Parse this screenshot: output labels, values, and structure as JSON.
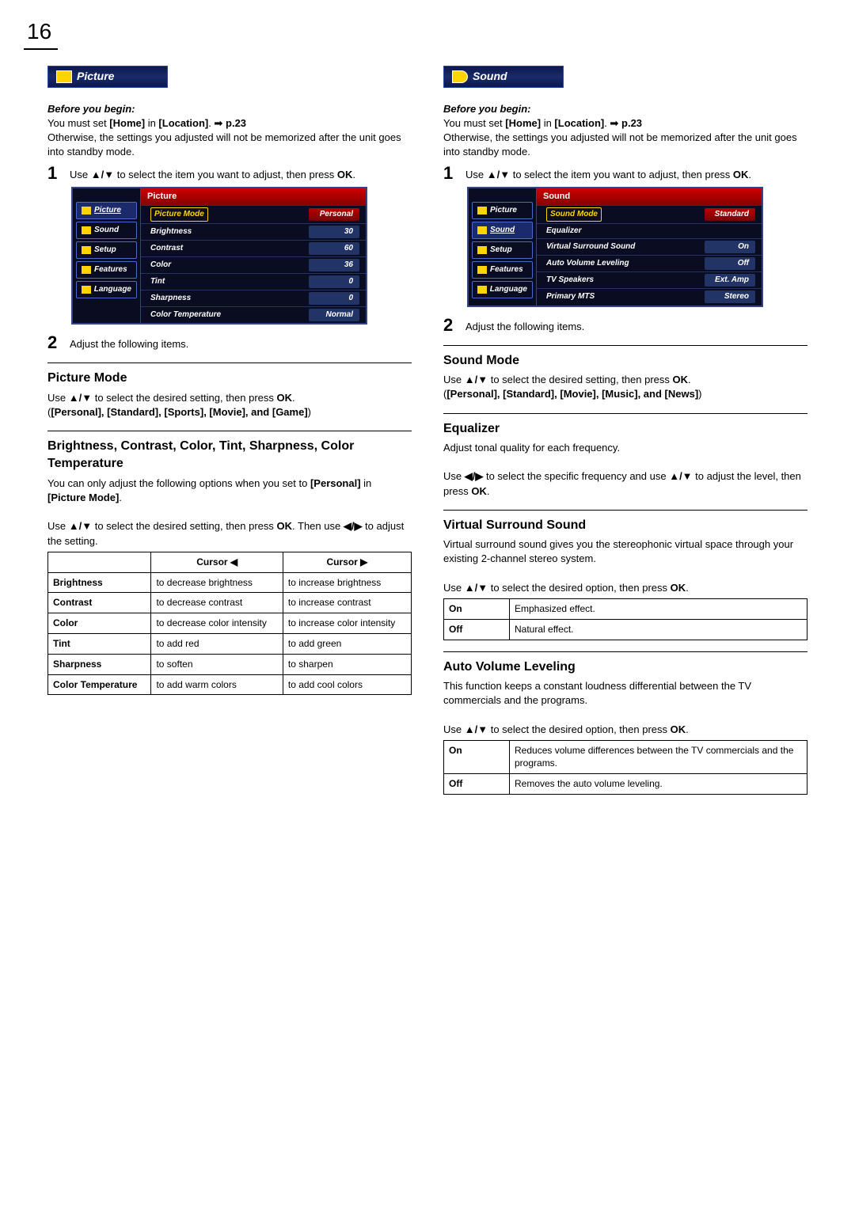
{
  "page_number": "16",
  "left": {
    "tab_title": "Picture",
    "before_heading": "Before you begin:",
    "before_line1_a": "You must set ",
    "before_line1_b": "[Home]",
    "before_line1_c": " in ",
    "before_line1_d": "[Location]",
    "before_line1_e": ". ",
    "before_pref": "p.23",
    "before_line2": "Otherwise, the settings you adjusted will not be memorized after the unit goes into standby mode.",
    "step1_a": "Use ",
    "step1_b": " to select the item you want to adjust, then press ",
    "step1_c": "OK",
    "step1_d": ".",
    "osd_header": "Picture",
    "osd_side": [
      "Picture",
      "Sound",
      "Setup",
      "Features",
      "Language"
    ],
    "osd_rows": [
      {
        "k": "Picture Mode",
        "v": "Personal",
        "hl": true,
        "red": true
      },
      {
        "k": "Brightness",
        "v": "30"
      },
      {
        "k": "Contrast",
        "v": "60"
      },
      {
        "k": "Color",
        "v": "36"
      },
      {
        "k": "Tint",
        "v": "0"
      },
      {
        "k": "Sharpness",
        "v": "0"
      },
      {
        "k": "Color Temperature",
        "v": "Normal"
      }
    ],
    "step2": "Adjust the following items.",
    "pm_head": "Picture Mode",
    "pm_line_a": "Use ",
    "pm_line_b": " to select the desired setting, then press ",
    "pm_line_c": "OK",
    "pm_line_d": ".",
    "pm_opts_a": "(",
    "pm_opts_list": "[Personal], [Standard], [Sports], [Movie], and [Game]",
    "pm_opts_b": ")",
    "bc_head": "Brightness, Contrast, Color, Tint, Sharpness, Color Temperature",
    "bc_line1_a": "You can only adjust the following options when you set to ",
    "bc_line1_b": "[Personal]",
    "bc_line1_c": " in ",
    "bc_line1_d": "[Picture Mode]",
    "bc_line1_e": ".",
    "bc_line2_a": "Use ",
    "bc_line2_b": " to select the desired setting, then press ",
    "bc_line2_c": "OK",
    "bc_line2_d": ". Then use ",
    "bc_line2_e": " to adjust the setting.",
    "bc_table": {
      "head_left": "Cursor ◀",
      "head_right": "Cursor ▶",
      "rows": [
        {
          "label": "Brightness",
          "l": "to decrease brightness",
          "r": "to increase brightness"
        },
        {
          "label": "Contrast",
          "l": "to decrease contrast",
          "r": "to increase contrast"
        },
        {
          "label": "Color",
          "l": "to decrease color intensity",
          "r": "to increase color intensity"
        },
        {
          "label": "Tint",
          "l": "to add red",
          "r": "to add green"
        },
        {
          "label": "Sharpness",
          "l": "to soften",
          "r": "to sharpen"
        },
        {
          "label": "Color Temperature",
          "l": "to add warm colors",
          "r": "to add cool colors"
        }
      ]
    }
  },
  "right": {
    "tab_title": "Sound",
    "before_heading": "Before you begin:",
    "before_line1_a": "You must set ",
    "before_line1_b": "[Home]",
    "before_line1_c": " in ",
    "before_line1_d": "[Location]",
    "before_line1_e": ". ",
    "before_pref": "p.23",
    "before_line2": "Otherwise, the settings you adjusted will not be memorized after the unit goes into standby mode.",
    "step1_a": "Use ",
    "step1_b": " to select the item you want to adjust, then press ",
    "step1_c": "OK",
    "step1_d": ".",
    "osd_header": "Sound",
    "osd_side": [
      "Picture",
      "Sound",
      "Setup",
      "Features",
      "Language"
    ],
    "osd_rows": [
      {
        "k": "Sound Mode",
        "v": "Standard",
        "hl": true,
        "red": true
      },
      {
        "k": "Equalizer",
        "v": ""
      },
      {
        "k": "Virtual Surround Sound",
        "v": "On"
      },
      {
        "k": "Auto Volume Leveling",
        "v": "Off"
      },
      {
        "k": "TV Speakers",
        "v": "Ext. Amp"
      },
      {
        "k": "Primary MTS",
        "v": "Stereo"
      }
    ],
    "step2": "Adjust the following items.",
    "sm_head": "Sound Mode",
    "sm_line_a": "Use ",
    "sm_line_b": " to select the desired setting, then press ",
    "sm_line_c": "OK",
    "sm_line_d": ".",
    "sm_opts_a": "(",
    "sm_opts_list": "[Personal], [Standard], [Movie], [Music], and [News]",
    "sm_opts_b": ")",
    "eq_head": "Equalizer",
    "eq_line1": "Adjust tonal quality for each frequency.",
    "eq_line2_a": "Use ",
    "eq_line2_b": " to select the specific frequency and use ",
    "eq_line2_c": " to adjust the level, then press ",
    "eq_line2_d": "OK",
    "eq_line2_e": ".",
    "vss_head": "Virtual Surround Sound",
    "vss_line1": "Virtual surround sound gives you the stereophonic virtual space through your existing 2-channel stereo system.",
    "vss_line2_a": "Use ",
    "vss_line2_b": " to select the desired option, then press ",
    "vss_line2_c": "OK",
    "vss_line2_d": ".",
    "vss_table": [
      {
        "k": "On",
        "v": "Emphasized effect."
      },
      {
        "k": "Off",
        "v": "Natural effect."
      }
    ],
    "avl_head": "Auto Volume Leveling",
    "avl_line1": "This function keeps a constant loudness differential between the TV commercials and the programs.",
    "avl_line2_a": "Use ",
    "avl_line2_b": " to select the desired option, then press ",
    "avl_line2_c": "OK",
    "avl_line2_d": ".",
    "avl_table": [
      {
        "k": "On",
        "v": "Reduces volume differences between the TV commercials and the programs."
      },
      {
        "k": "Off",
        "v": "Removes the auto volume leveling."
      }
    ]
  },
  "glyphs": {
    "updown": "▲/▼",
    "leftright": "◀/▶",
    "goto": "➟"
  }
}
